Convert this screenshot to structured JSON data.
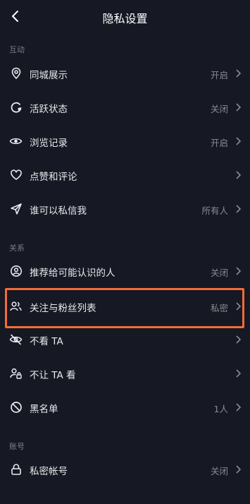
{
  "header": {
    "title": "隐私设置"
  },
  "sections": {
    "interaction": "互动",
    "relations": "关系",
    "account": "账号"
  },
  "rows": {
    "city": {
      "label": "同城展示",
      "value": "开启"
    },
    "active": {
      "label": "活跃状态",
      "value": "关闭"
    },
    "history": {
      "label": "浏览记录",
      "value": "开启"
    },
    "likes": {
      "label": "点赞和评论",
      "value": ""
    },
    "message": {
      "label": "谁可以私信我",
      "value": "所有人"
    },
    "recommend": {
      "label": "推荐给可能认识的人",
      "value": "关闭"
    },
    "follow": {
      "label": "关注与粉丝列表",
      "value": "私密"
    },
    "hide_ta": {
      "label": "不看 TA",
      "value": ""
    },
    "block_ta": {
      "label": "不让 TA 看",
      "value": ""
    },
    "blacklist": {
      "label": "黑名单",
      "value": "1人"
    },
    "private": {
      "label": "私密帐号",
      "value": "关闭"
    }
  },
  "highlight_color": "#f36b39",
  "background_color": "#161823"
}
